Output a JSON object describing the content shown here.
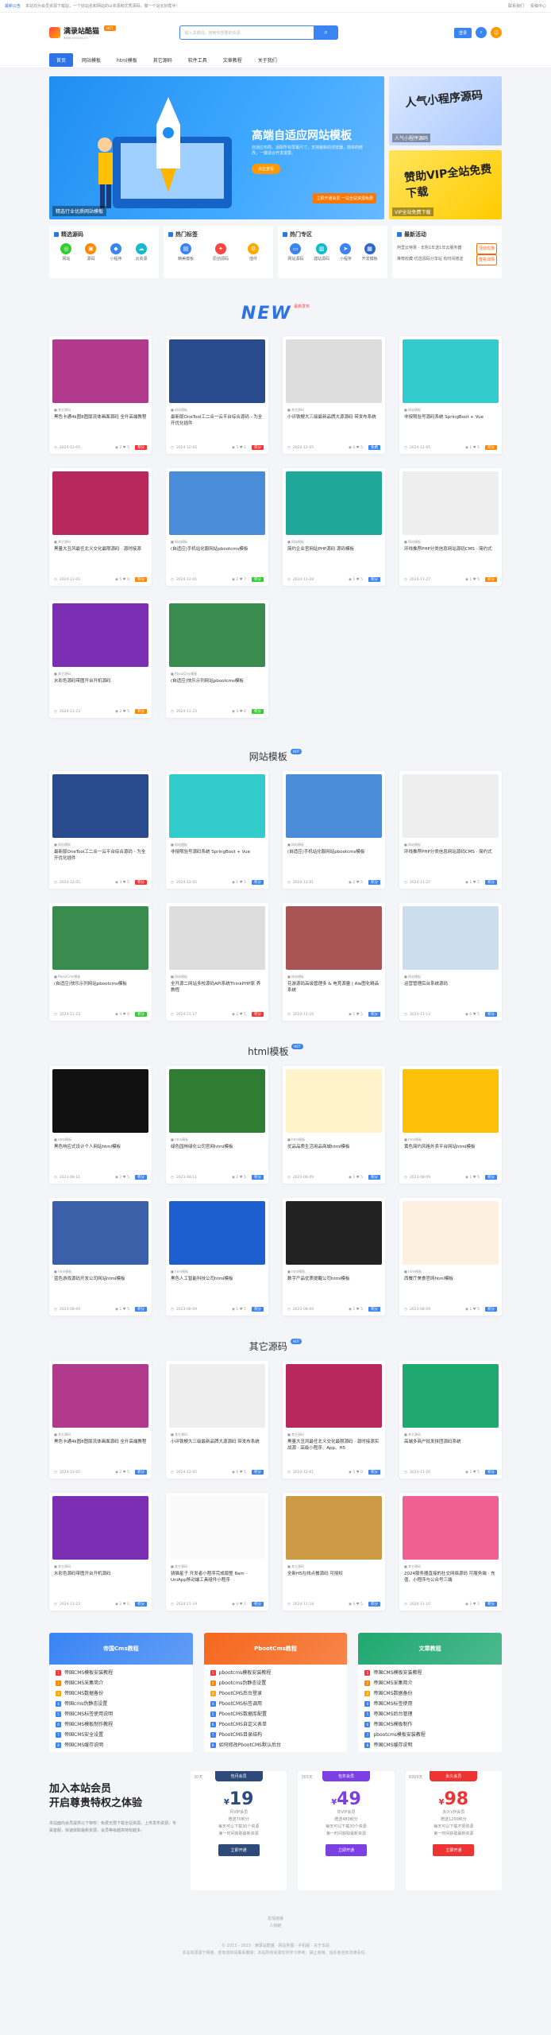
{
  "topbar": {
    "announce": "最新公告",
    "msg": "本站均为会员资源下载站，一个好站名和网站的ui资源和优秀源码，做一个站长好帮手！",
    "links": [
      "联系我们",
      "投稿中心"
    ]
  },
  "header": {
    "logo_title": "满录站酷猫",
    "logo_sub": "www.xxxxxx.cn",
    "hot": "HOT",
    "search_placeholder": "输入关键词，搜索你想要的资源",
    "login": "登录",
    "colors": {
      "accent": "#2d73e6"
    }
  },
  "nav": [
    "首页",
    "网站模板",
    "html模板",
    "其它源码",
    "软件工具",
    "文章教程",
    "关于我们"
  ],
  "banner": {
    "title": "高端自适应网站模板",
    "desc": "自适应布局，适配所有屏幕尺寸，支持最新的浏览器，简单的修改，一键适合开发需要。",
    "btn": "点击查看",
    "caption": "精选行业优质网站模板",
    "tag": "立即开通会员\n一站全站资源免费",
    "side1": "人气小程序源码",
    "side1_cap": "人气小程序源码",
    "side2": "赞助VIP全站免费下载",
    "side2_cap": "VIP全站免费下载"
  },
  "quick": [
    {
      "title": "精选源码",
      "items": [
        "网站",
        "源码",
        "小程序",
        "云资源"
      ]
    },
    {
      "title": "热门标签",
      "items": [
        "精美模板",
        "原创源码",
        "插件"
      ]
    },
    {
      "title": "热门专区",
      "items": [
        "网站源码",
        "建站源码",
        "小程序",
        "开发模板"
      ]
    },
    {
      "title": "最新活动",
      "list": [
        {
          "t": "阿里云特惠 - 年购1年送1年云服务器",
          "tag": "活动优惠"
        },
        {
          "t": "推荐收藏-优选源码分享站 有时间赠送",
          "tag": "查看详情"
        }
      ]
    }
  ],
  "new_section": {
    "title": "NEW",
    "sub": "最新发布"
  },
  "new_cards": [
    {
      "cat": "其它源码",
      "title": "黑色卡通4k图8图版流体画面源码 全升高端教程",
      "date": "2024-12-05",
      "views": "2",
      "likes": "5",
      "price": "积分",
      "pc": "#f33",
      "img": "#b23a8c"
    },
    {
      "cat": "网站模板",
      "title": "最新版OneTool工二合一云平台综合源码 - 为全开优化插件",
      "date": "2024-12-05",
      "views": "5",
      "likes": "1",
      "price": "积分",
      "pc": "#f33",
      "img": "#2a4a8e"
    },
    {
      "cat": "其它源码",
      "title": "小评铁梗大三级最新品牌大源源码 带发布系统",
      "date": "2024-12-05",
      "views": "0",
      "likes": "5",
      "price": "免费",
      "pc": "#3a84f3",
      "img": "#ddd"
    },
    {
      "cat": "网站模板",
      "title": "非授限验号源码系统 SpringBoot + Vue",
      "date": "2024-12-05",
      "views": "1",
      "likes": "5",
      "price": "积分",
      "pc": "#f80",
      "img": "#3cc"
    },
    {
      "cat": "其它源码",
      "title": "黑量大丑风最任北义交化最限源码 · 源时接源",
      "date": "2024-12-01",
      "views": "5",
      "likes": "0",
      "price": "积分",
      "pc": "#f80",
      "img": "#b8285a"
    },
    {
      "cat": "网站模板",
      "title": "(自适应)手机站化服网站pbootcms模板",
      "date": "2024-12-01",
      "views": "2",
      "likes": "7",
      "price": "积分",
      "pc": "#3c3",
      "img": "#4b8cd8"
    },
    {
      "cat": "网站模板",
      "title": "简约企业官网站PHP源码 源码模板",
      "date": "2024-11-28",
      "views": "1",
      "likes": "5",
      "price": "积分",
      "pc": "#3a84f3",
      "img": "#1fa89a"
    },
    {
      "cat": "网站模板",
      "title": "环线推荐PHP分类信息网站源码CMS · 简约式",
      "date": "2024-11-27",
      "views": "1",
      "likes": "5",
      "price": "积分",
      "pc": "#f80",
      "img": "#eee"
    },
    {
      "cat": "其它源码",
      "title": "水彩色源码带图开台开机源码",
      "date": "2024-11-23",
      "views": "2",
      "likes": "5",
      "price": "积分",
      "pc": "#f80",
      "img": "#7a2fb3"
    },
    {
      "cat": "PbootCms模板",
      "title": "(自适应)快乐示列网站pbootcms模板",
      "date": "2024-11-23",
      "views": "4",
      "likes": "0",
      "price": "积分",
      "pc": "#3c3",
      "img": "#3a8c4e"
    }
  ],
  "web_section": {
    "title": "网站模板",
    "badge": "HOT"
  },
  "web_cards": [
    {
      "cat": "网站模板",
      "title": "最新版OneTool工二合一云平台综合源码 - 为全开优化插件",
      "date": "2024-12-05",
      "views": "3",
      "likes": "5",
      "price": "积分",
      "pc": "#f33",
      "img": "#2a4a8e"
    },
    {
      "cat": "网站模板",
      "title": "非授限验号源码系统 SpringBoot + Vue",
      "date": "2024-12-05",
      "views": "1",
      "likes": "5",
      "price": "积分",
      "pc": "#3a84f3",
      "img": "#3cc"
    },
    {
      "cat": "网站模板",
      "title": "(自适应)手机站化服网站pbootcms模板",
      "date": "2024-12-01",
      "views": "2",
      "likes": "5",
      "price": "积分",
      "pc": "#3a84f3",
      "img": "#4b8cd8"
    },
    {
      "cat": "网站模板",
      "title": "环线推荐PHP分类信息网站源码CMS · 简约式",
      "date": "2024-11-27",
      "views": "1",
      "likes": "5",
      "price": "积分",
      "pc": "#3a84f3",
      "img": "#eee"
    },
    {
      "cat": "PbootCms模板",
      "title": "(自适应)快乐示列网站pbootcms模板",
      "date": "2024-11-23",
      "views": "4",
      "likes": "0",
      "price": "积分",
      "pc": "#3c3",
      "img": "#3a8c4e"
    },
    {
      "cat": "网站模板",
      "title": "全开源二网站多校源码API系统ThinkPHP原 养教程",
      "date": "2024-11-17",
      "views": "2",
      "likes": "5",
      "price": "积分",
      "pc": "#f33",
      "img": "#ddd"
    },
    {
      "cat": "网站模板",
      "title": "花游源码高级管理多 & 电竞源量 | Ale图化精品系统",
      "date": "2024-11-16",
      "views": "1",
      "likes": "5",
      "price": "积分",
      "pc": "#3a84f3",
      "img": "#a55"
    },
    {
      "cat": "网站模板",
      "title": "运营管理后台系统源码",
      "date": "2024-11-13",
      "views": "0",
      "likes": "5",
      "price": "积分",
      "pc": "#3a84f3",
      "img": "#cde"
    }
  ],
  "html_section": {
    "title": "html模板",
    "badge": "HOT"
  },
  "html_cards": [
    {
      "cat": "html模板",
      "title": "黑色响应式设计个人网站html模板",
      "date": "2023-08-11",
      "views": "2",
      "likes": "5",
      "price": "积分",
      "pc": "#3a84f3",
      "img": "#111"
    },
    {
      "cat": "html模板",
      "title": "绿色园林绿化公司官网html模板",
      "date": "2023-08-11",
      "views": "2",
      "likes": "5",
      "price": "积分",
      "pc": "#3a84f3",
      "img": "#2e7d32"
    },
    {
      "cat": "html模板",
      "title": "优品品质生活用品商城html模板",
      "date": "2023-08-09",
      "views": "1",
      "likes": "5",
      "price": "积分",
      "pc": "#3a84f3",
      "img": "#fff3cc"
    },
    {
      "cat": "html模板",
      "title": "黄色简约风格外卖平台网站html模板",
      "date": "2023-08-09",
      "views": "1",
      "likes": "5",
      "price": "积分",
      "pc": "#3a84f3",
      "img": "#ffc107"
    },
    {
      "cat": "html模板",
      "title": "蓝色游戏源码开发公司网站html模板",
      "date": "2023-08-09",
      "views": "1",
      "likes": "5",
      "price": "积分",
      "pc": "#3a84f3",
      "img": "#3b5fa8"
    },
    {
      "cat": "html模板",
      "title": "黑色人工智能科技公司html模板",
      "date": "2023-08-09",
      "views": "1",
      "likes": "5",
      "price": "积分",
      "pc": "#3a84f3",
      "img": "#1e5fd0"
    },
    {
      "cat": "html模板",
      "title": "数字产品优质提醒公司html模板",
      "date": "2023-08-09",
      "views": "1",
      "likes": "5",
      "price": "积分",
      "pc": "#3a84f3",
      "img": "#222"
    },
    {
      "cat": "html模板",
      "title": "西餐厅美食官网html模板",
      "date": "2023-08-09",
      "views": "1",
      "likes": "5",
      "price": "积分",
      "pc": "#3a84f3",
      "img": "#fdf0e0"
    }
  ],
  "other_section": {
    "title": "其它源码",
    "badge": "HOT"
  },
  "other_cards": [
    {
      "cat": "其它源码",
      "title": "黑色卡通4k图8图版流体画面源码 全升高端教程",
      "date": "2024-12-05",
      "views": "2",
      "likes": "5",
      "price": "积分",
      "pc": "#3a84f3",
      "img": "#b23a8c"
    },
    {
      "cat": "其它源码",
      "title": "小评铁梗大三级最新品牌大源源码 带发布系统",
      "date": "2024-12-05",
      "views": "0",
      "likes": "5",
      "price": "积分",
      "pc": "#3a84f3",
      "img": "#eee"
    },
    {
      "cat": "其它源码",
      "title": "黑量大丑风最任北义交化最限源码 · 源时接源实战源 · 高级小程序、App、H5",
      "date": "2024-12-01",
      "views": "5",
      "likes": "0",
      "price": "积分",
      "pc": "#3a84f3",
      "img": "#b8285a"
    },
    {
      "cat": "其它源码",
      "title": "高端多商户批发拼团源码系统",
      "date": "2024-11-20",
      "views": "2",
      "likes": "5",
      "price": "积分",
      "pc": "#3a84f3",
      "img": "#1fa870"
    },
    {
      "cat": "其它源码",
      "title": "水彩色源码带图开台开机源码",
      "date": "2024-11-23",
      "views": "2",
      "likes": "5",
      "price": "积分",
      "pc": "#3a84f3",
      "img": "#7a2fb3"
    },
    {
      "cat": "其它源码",
      "title": "骑猫星子 开发者小程序完成版整 8am · UniApp移动端工具组件小程序",
      "date": "2024-11-19",
      "views": "0",
      "likes": "5",
      "price": "积分",
      "pc": "#3a84f3",
      "img": "#fafafa"
    },
    {
      "cat": "其它源码",
      "title": "全新H5在线点餐源码 可授权",
      "date": "2024-11-18",
      "views": "0",
      "likes": "5",
      "price": "积分",
      "pc": "#3a84f3",
      "img": "#c94"
    },
    {
      "cat": "其它源码",
      "title": "2024服务器直接的社交网络源码 可服务端 · 充值、小程序与公众号三端",
      "date": "2024-11-10",
      "views": "2",
      "likes": "5",
      "price": "积分",
      "pc": "#3a84f3",
      "img": "#f06090"
    }
  ],
  "boxes": [
    {
      "title": "帝国Cms教程",
      "color": "#3a84f3",
      "items": [
        "帝国CMS模板安装教程",
        "帝国CMS采集简介",
        "帝国CMS数据备份",
        "帝国cms伪静态设置",
        "帝国CMS标签使用说明",
        "帝国CMS模板制作教程",
        "帝国CMS安全设置",
        "帝国CMS缓存说明"
      ]
    },
    {
      "title": "PbootCms教程",
      "color": "#f5671d",
      "items": [
        "pbootcms模板安装教程",
        "pbootcms伪静态设置",
        "PbootCMS后台登录",
        "PbootCMS标签调用",
        "PbootCMS数据库配置",
        "PbootCMS自定义表单",
        "PbootCMS目录结构",
        "如何修改PbootCMS默认后台"
      ]
    },
    {
      "title": "文章教程",
      "color": "#1fa870",
      "items": [
        "帝国CMS模板安装教程",
        "帝国CMS采集简介",
        "帝国CMS数据备份",
        "帝国CMS标签使用",
        "帝国CMS后台管理",
        "帝国CMS模板制作",
        "pbootcms模板安装教程",
        "帝国CMS缓存说明"
      ]
    }
  ],
  "vip": {
    "title1": "加入本站会员",
    "title2": "开启尊贵特权之体验",
    "desc": "本站面向会员提供以下特权：免费无限下载全站资源，上传发布资源，专属客服，快速获取最新资源，会员等级越高特权越多。",
    "plans": [
      {
        "tl": "30天",
        "tr": "",
        "head": "包月会员",
        "color": "#2d4a7a",
        "price": "19",
        "l1": "月VIP会员",
        "l2": "赠送70积分",
        "l3": "每天可以下载30个资源",
        "l4": "第一时间获取最新资源",
        "btn": "立即开通"
      },
      {
        "tl": "365天",
        "tr": "",
        "head": "包年会员",
        "color": "#7b3fe4",
        "price": "49",
        "l1": "年VIP会员",
        "l2": "赠送480积分",
        "l3": "每天可以下载30个资源",
        "l4": "第一时间获取最新资源",
        "btn": "立即开通"
      },
      {
        "tl": "9999天",
        "tr": "",
        "head": "永久会员",
        "color": "#e33",
        "price": "98",
        "l1": "永久VIP会员",
        "l2": "赠送1200积分",
        "l3": "每天可以下载不限资源",
        "l4": "第一时间获取最新资源",
        "btn": "立即开通"
      }
    ]
  },
  "footer": {
    "l1": "友情链接",
    "l2": "人物链",
    "l3": "© 2013 - 2023 · 满录站酷猫 · 网站地图 · 手机版 · 关于本站",
    "l4": "本站资源源于网络，若有侵权请联系删除；本站所有资源仅供学习参考，禁止商用，违反者自负法律责任。"
  }
}
